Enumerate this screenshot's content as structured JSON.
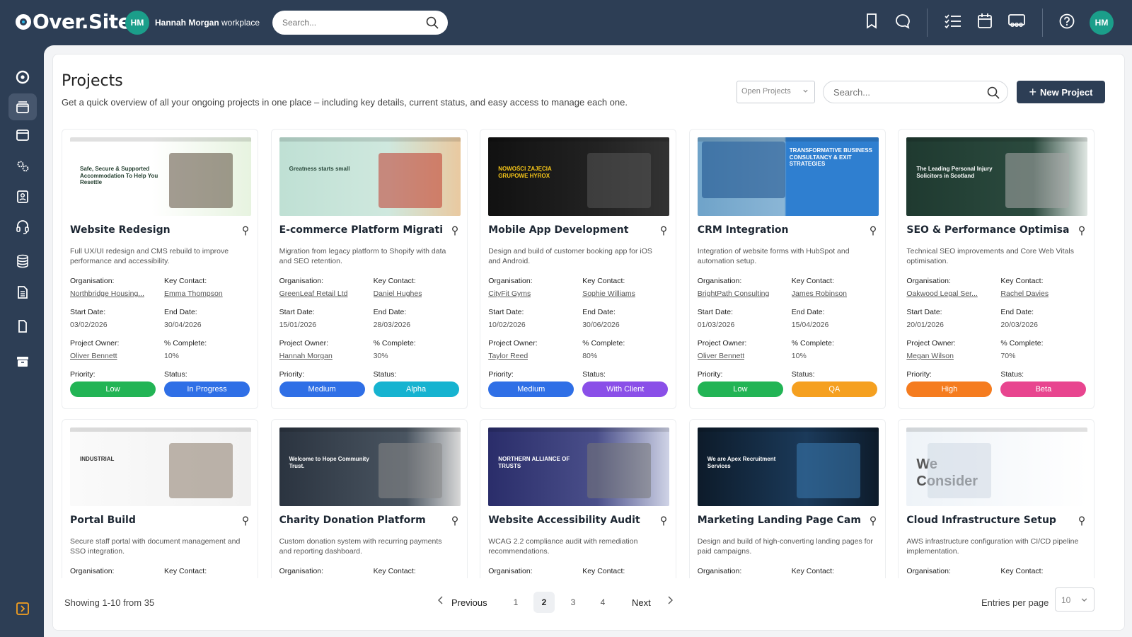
{
  "topbar": {
    "logo": "Over.Site",
    "workspace_initials": "HM",
    "workspace_name": "Hannah Morgan",
    "workspace_suffix": "workplace",
    "search_placeholder": "Search...",
    "icons": [
      "bookmark-icon",
      "chat-icon",
      "task-list-icon",
      "calendar-icon",
      "team-icon",
      "help-icon"
    ],
    "user_initials": "HM"
  },
  "sidebar": {
    "items": [
      "dashboard-icon",
      "projects-icon",
      "browser-icon",
      "settings-gears-icon",
      "contacts-icon",
      "support-icon",
      "database-icon",
      "document-icon",
      "file-icon",
      "archive-icon"
    ],
    "active_index": 1
  },
  "page": {
    "title": "Projects",
    "subtitle": "Get a quick overview of all your ongoing projects in one place – including key details, current status, and easy access to manage each one.",
    "filter_value": "Open Projects",
    "search_placeholder": "Search...",
    "new_button": "New Project"
  },
  "labels": {
    "organisation": "Organisation:",
    "key_contact": "Key Contact:",
    "start_date": "Start Date:",
    "end_date": "End Date:",
    "project_owner": "Project Owner:",
    "complete": "% Complete:",
    "priority": "Priority:",
    "status": "Status:"
  },
  "colors": {
    "low": "#22b455",
    "medium": "#2f6fe6",
    "high": "#f57c1f",
    "in_progress": "#2f6fe6",
    "alpha": "#16b3d0",
    "with_client": "#8a4fe8",
    "qa": "#f5a020",
    "beta": "#e8458f",
    "sidebar": "#2d3e55"
  },
  "projects": [
    {
      "title": "Website Redesign",
      "desc": "Full UX/UI redesign and CMS rebuild to improve performance and accessibility.",
      "org": "Northbridge Housing...",
      "contact": "Emma Thompson",
      "start": "03/02/2026",
      "end": "30/04/2026",
      "owner": "Oliver Bennett",
      "complete": "10%",
      "priority": "Low",
      "status": "In Progress",
      "thumb_text": "Safe, Secure & Supported Accommodation To Help You Resettle"
    },
    {
      "title": "E-commerce Platform Migration",
      "desc": "Migration from legacy platform to Shopify with data and SEO retention.",
      "org": "GreenLeaf Retail Ltd",
      "contact": "Daniel Hughes",
      "start": "15/01/2026",
      "end": "28/03/2026",
      "owner": "Hannah Morgan",
      "complete": "30%",
      "priority": "Medium",
      "status": "Alpha",
      "thumb_text": "Greatness starts small"
    },
    {
      "title": "Mobile App Development",
      "desc": "Design and build of customer booking app for iOS and Android.",
      "org": "CityFit Gyms",
      "contact": "Sophie Williams",
      "start": "10/02/2026",
      "end": "30/06/2026",
      "owner": "Taylor Reed",
      "complete": "80%",
      "priority": "Medium",
      "status": "With Client",
      "thumb_text": "NOWOŚCI ZAJĘCIA GRUPOWE HYROX"
    },
    {
      "title": "CRM Integration",
      "desc": "Integration of website forms with HubSpot and automation setup.",
      "org": "BrightPath Consulting",
      "contact": "James Robinson",
      "start": "01/03/2026",
      "end": "15/04/2026",
      "owner": "Oliver Bennett",
      "complete": "10%",
      "priority": "Low",
      "status": "QA",
      "thumb_text": "TRANSFORMATIVE BUSINESS CONSULTANCY & EXIT STRATEGIES"
    },
    {
      "title": "SEO & Performance Optimisation",
      "desc": "Technical SEO improvements and Core Web Vitals optimisation.",
      "org": "Oakwood Legal Ser...",
      "contact": "Rachel Davies",
      "start": "20/01/2026",
      "end": "20/03/2026",
      "owner": "Megan Wilson",
      "complete": "70%",
      "priority": "High",
      "status": "Beta",
      "thumb_text": "The Leading Personal Injury Solicitors in Scotland"
    },
    {
      "title": "Portal Build",
      "desc": "Secure staff portal with document management and SSO integration.",
      "thumb_text": "INDUSTRIAL"
    },
    {
      "title": "Charity Donation Platform",
      "desc": "Custom donation system with recurring payments and reporting dashboard.",
      "thumb_text": "Welcome to Hope Community Trust."
    },
    {
      "title": "Website Accessibility Audit",
      "desc": "WCAG 2.2 compliance audit with remediation recommendations.",
      "thumb_text": "NORTHERN ALLIANCE OF TRUSTS"
    },
    {
      "title": "Marketing Landing Page Cam...",
      "desc": "Design and build of high-converting landing pages for paid campaigns.",
      "thumb_text": "We are Apex Recruitment Services"
    },
    {
      "title": "Cloud Infrastructure Setup",
      "desc": "AWS infrastructure configuration with CI/CD pipeline implementation.",
      "thumb_text": "We Consider"
    }
  ],
  "footer": {
    "showing": "Showing 1-10 from 35",
    "previous": "Previous",
    "next": "Next",
    "pages": [
      "1",
      "2",
      "3",
      "4"
    ],
    "current_page": "2",
    "entries_label": "Entries per page",
    "entries_value": "10"
  }
}
